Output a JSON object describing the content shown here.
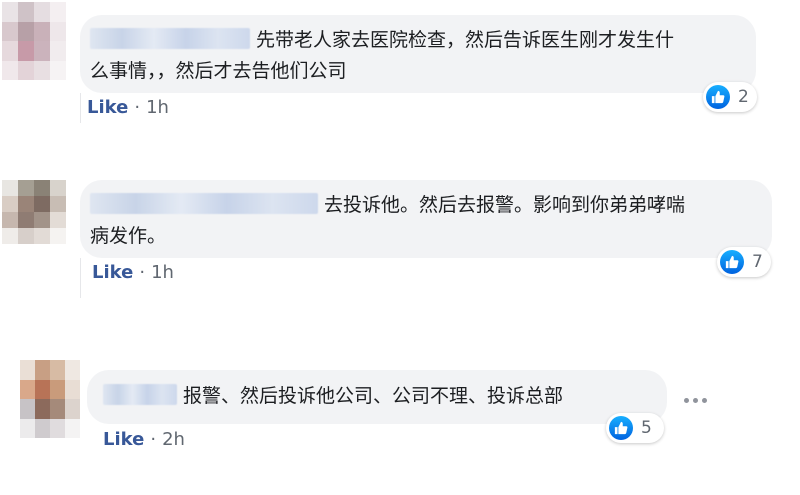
{
  "comments": [
    {
      "text_line1": "先带老人家去医院检查，然后告诉医生刚才发生什",
      "text_line2": "么事情，，然后才去告他们公司",
      "like_label": "Like",
      "separator": "·",
      "time": "1h",
      "reaction_count": "2",
      "avatar_colors": [
        "#e9e3e6",
        "#cfc2c7",
        "#e5dde1",
        "#f4eff1",
        "#d8c8cd",
        "#b7a0a7",
        "#c9b1b9",
        "#eee7ea",
        "#e6d9dd",
        "#c79aa8",
        "#cbb3bc",
        "#f1ecee",
        "#f0e8eb",
        "#e3d3d8",
        "#e8dfe2",
        "#f6f3f4"
      ]
    },
    {
      "text_line1": "去投诉他。然后去报警。影响到你弟弟哮喘",
      "text_line2": "病发作。",
      "like_label": "Like",
      "separator": "·",
      "time": "1h",
      "reaction_count": "7",
      "avatar_colors": [
        "#e8e6e2",
        "#a59f93",
        "#8a8276",
        "#d8d3cc",
        "#d9cdc4",
        "#9a8478",
        "#7e6b62",
        "#c8bdb4",
        "#c6b7ae",
        "#8f7c73",
        "#a29389",
        "#e3dcd6",
        "#efece9",
        "#d7cfca",
        "#e2dbd6",
        "#f5f3f1"
      ]
    },
    {
      "text_line1": "报警、然后投诉他公司、公司不理、投诉总部",
      "like_label": "Like",
      "separator": "·",
      "time": "2h",
      "reaction_count": "5",
      "more_options": "···",
      "avatar_colors": [
        "#eadfd6",
        "#c89f84",
        "#d7bba4",
        "#efe8e2",
        "#d9a88a",
        "#b87357",
        "#c99b7b",
        "#e8ddd4",
        "#c7c3c6",
        "#8c6a5c",
        "#a58a7a",
        "#dcd3cd",
        "#ecebec",
        "#cfcbce",
        "#e0dcde",
        "#f4f3f3"
      ]
    }
  ],
  "colors": {
    "bubble_bg": "#f2f3f5",
    "like_link": "#385898",
    "meta_text": "#606770",
    "like_reaction": "#1877f2"
  },
  "icons": {
    "reaction": "thumbs-up-icon",
    "more": "more-dots-icon"
  }
}
